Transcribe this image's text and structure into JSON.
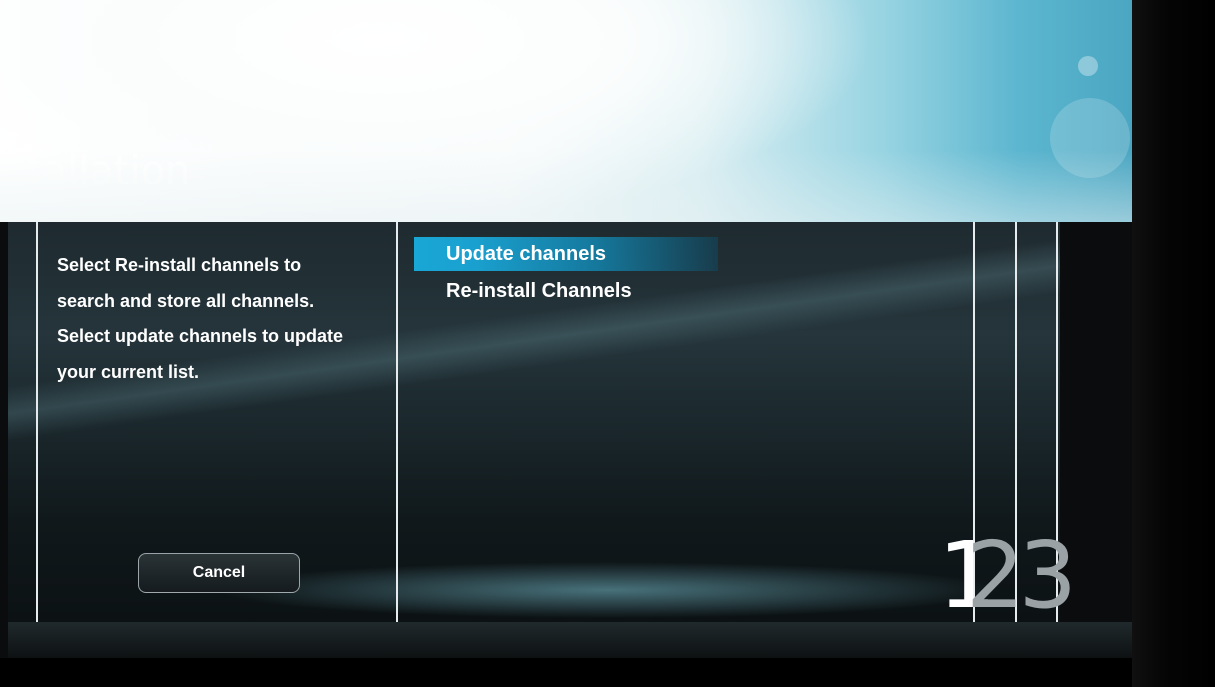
{
  "window": {
    "title": "stallation"
  },
  "description": {
    "text": "Select Re-install channels to\nsearch and store all channels.\nSelect update channels to update\nyour current list."
  },
  "menu": {
    "items": [
      {
        "label": "Update channels",
        "selected": true
      },
      {
        "label": "Re-install Channels",
        "selected": false
      }
    ]
  },
  "buttons": {
    "cancel_label": "Cancel"
  },
  "steps": {
    "current": "1",
    "remaining": "23"
  },
  "colors": {
    "accent": "#19a7d6",
    "step_current": "#ffffff",
    "step_inactive": "#9aa2a5"
  }
}
